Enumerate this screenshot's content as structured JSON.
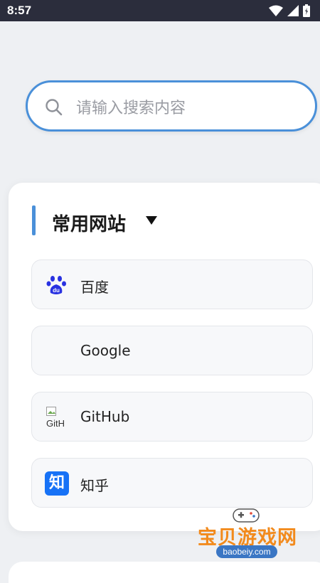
{
  "status_bar": {
    "time": "8:57",
    "icons": [
      "wifi-icon",
      "signal-icon",
      "battery-icon"
    ]
  },
  "search": {
    "placeholder": "请输入搜索内容",
    "value": ""
  },
  "section": {
    "title": "常用网站",
    "toggle_icon": "triangle-down-icon"
  },
  "sites": [
    {
      "label": "百度",
      "icon": "baidu-paw-icon"
    },
    {
      "label": "Google",
      "icon": ""
    },
    {
      "label": "GitHub",
      "icon": "broken-image-icon",
      "icon_alt_text": "GitH"
    },
    {
      "label": "知乎",
      "icon": "zhihu-icon",
      "icon_text": "知"
    }
  ],
  "watermark": {
    "title": "宝贝游戏网",
    "url": "baobeiy.com"
  },
  "colors": {
    "accent": "#4a90d9",
    "status_bar": "#2b2d3c",
    "zhihu": "#1772f6",
    "baidu": "#2932e1",
    "watermark": "#f28a1c"
  }
}
